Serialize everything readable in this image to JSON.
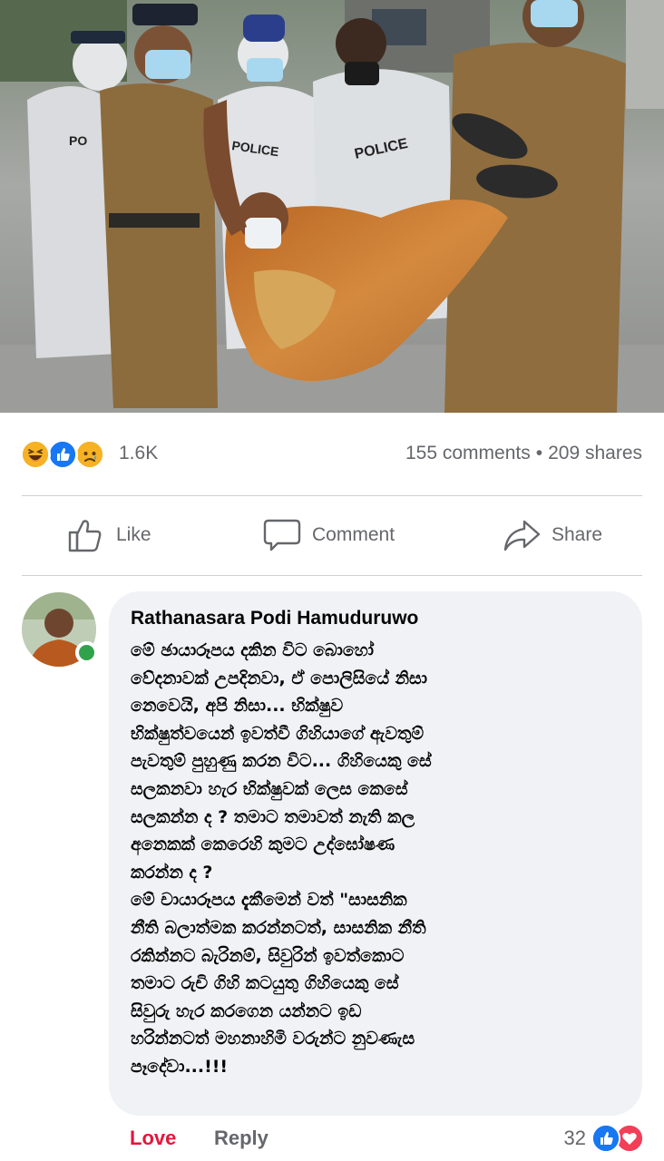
{
  "post": {
    "photo": {
      "labels": [
        "PO",
        "POLICE",
        "POLICE"
      ]
    },
    "reactions": {
      "icons": [
        "haha-icon",
        "like-icon",
        "sad-icon"
      ],
      "count": "1.6K"
    },
    "engagement": {
      "comments": "155 comments",
      "separator": "•",
      "shares": "209 shares"
    },
    "actions": {
      "like": "Like",
      "comment": "Comment",
      "share": "Share"
    }
  },
  "comment": {
    "author": "Rathanasara Podi Hamuduruwo",
    "lines": [
      "මේ ඡායාරූපය දකින විට බොහෝ",
      "වේදනාවක් උපදිනවා, ඒ පොලිසියේ නිසා",
      "නෙවෙයි, අපි නිසා... භික්ෂුව",
      "භික්ෂුත්වයෙන් ඉවත්වී ගිහියාගේ ඇවතුම්",
      "පැවතුම් පුහුණු කරන විට... ගිහියෙකු සේ",
      "සලකනවා හැර භික්ෂුවක් ලෙස කෙසේ",
      "සලකන්න ද ? තමාට තමාවත් නැති කල",
      "අනෙකක් කෙරෙහි කුමට උද්ඝෝෂණ",
      "කරන්න ද ?",
      "මේ චායාරූපය දැකීමෙන් වත් \"සාසනික",
      "නීති බලාත්මක කරන්නටත්, සාසනික නීති",
      "රකින්නට බැරිනම්, සිවුරින් ඉවත්කොට",
      "තමාට රුචි ගිහි කටයුතු ගිහියෙකු සේ",
      "සිවුරු හැර කරගෙන යන්නට ඉඩ",
      "හරින්නටත් මහනාහිමි වරුන්ට නුවණැස",
      "පෑදේවා...!!!"
    ],
    "footer": {
      "love": "Love",
      "reply": "Reply",
      "reaction_count": "32",
      "reaction_icons": [
        "like-icon",
        "love-icon"
      ]
    }
  },
  "colors": {
    "like_blue": "#1877f2",
    "love_red": "#f33e58",
    "haha_yellow": "#f7b125",
    "online_green": "#31a24c",
    "bubble_bg": "#f0f2f5",
    "muted_text": "#65676b",
    "robe_orange": "#c9782d",
    "police_khaki": "#8c6b3d"
  }
}
